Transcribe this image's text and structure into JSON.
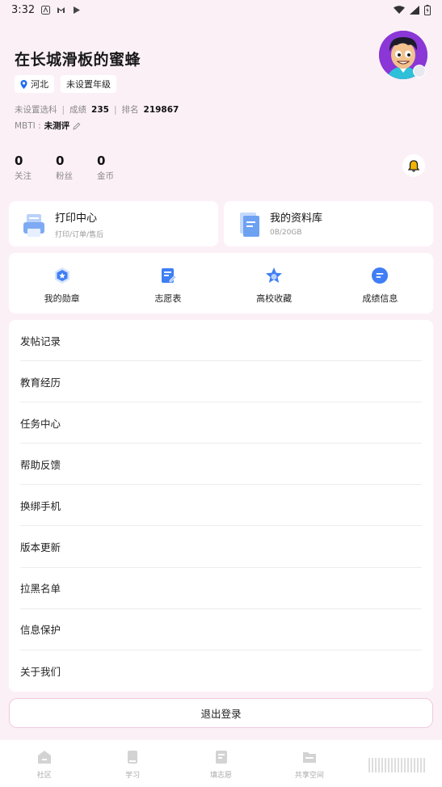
{
  "status_bar": {
    "time": "3:32"
  },
  "profile": {
    "username": "在长城滑板的蜜蜂",
    "location": "河北",
    "grade": "未设置年级",
    "subject": "未设置选科",
    "score_label": "成绩",
    "score": "235",
    "rank_label": "排名",
    "rank": "219867",
    "mbti_label": "MBTI :",
    "mbti_value": "未测评"
  },
  "counts": [
    {
      "num": "0",
      "label": "关注"
    },
    {
      "num": "0",
      "label": "粉丝"
    },
    {
      "num": "0",
      "label": "金币"
    }
  ],
  "cards": {
    "print": {
      "title": "打印中心",
      "sub": "打印/订单/售后"
    },
    "library": {
      "title": "我的资料库",
      "sub": "0B/20GB"
    }
  },
  "shortcuts": [
    {
      "label": "我的勋章",
      "icon": "medal-icon"
    },
    {
      "label": "志愿表",
      "icon": "form-icon"
    },
    {
      "label": "高校收藏",
      "icon": "star-icon"
    },
    {
      "label": "成绩信息",
      "icon": "chat-icon"
    }
  ],
  "menu": [
    "发帖记录",
    "教育经历",
    "任务中心",
    "帮助反馈",
    "换绑手机",
    "版本更新",
    "拉黑名单",
    "信息保护",
    "关于我们"
  ],
  "logout_label": "退出登录",
  "tabs": [
    {
      "label": "社区",
      "icon": "home-icon"
    },
    {
      "label": "学习",
      "icon": "book-icon"
    },
    {
      "label": "填志愿",
      "icon": "form-icon"
    },
    {
      "label": "共享空间",
      "icon": "folder-icon"
    }
  ],
  "colors": {
    "accent": "#1f6cf5",
    "background": "#fcf0f7"
  }
}
